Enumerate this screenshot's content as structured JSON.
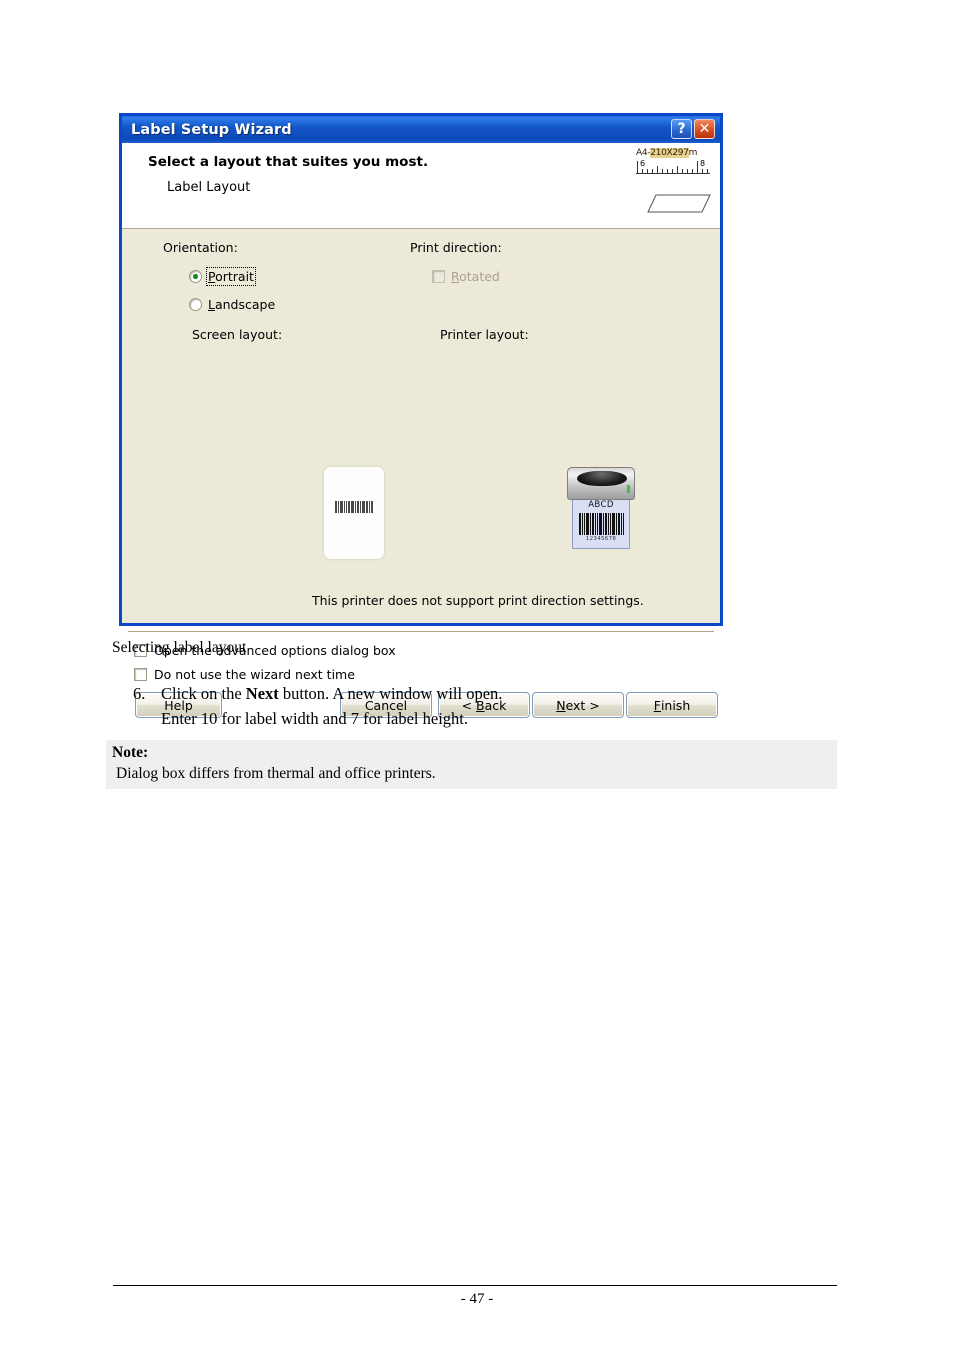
{
  "dialog": {
    "title": "Label Setup Wizard",
    "titlebar_buttons": [
      {
        "name": "help",
        "glyph": "?"
      },
      {
        "name": "close",
        "glyph": "✕"
      }
    ],
    "header": {
      "heading": "Select a layout that suites you most.",
      "subheading": "Label Layout",
      "paper_icon": {
        "prefix": "A4-",
        "highlight": "210X297",
        "suffix": "m",
        "ruler_labels": [
          "6",
          "8"
        ]
      }
    },
    "orientation": {
      "label": "Orientation:",
      "options": [
        {
          "label": "Portrait",
          "accel": "P",
          "selected": true,
          "focused": true
        },
        {
          "label": "Landscape",
          "accel": "L",
          "selected": false,
          "focused": false
        }
      ]
    },
    "print_direction": {
      "label": "Print direction:",
      "checkbox": {
        "label": "Rotated",
        "accel": "R",
        "checked": false,
        "disabled": true
      }
    },
    "screen_layout": {
      "label": "Screen layout:"
    },
    "printer_layout": {
      "label": "Printer layout:",
      "preview_text": "ABCD",
      "preview_number": "12345678"
    },
    "support_note": "This printer does not support print direction settings.",
    "footer_checkboxes": [
      {
        "label": "Open the advanced options dialog box",
        "checked": false
      },
      {
        "label": "Do not use the wizard next time",
        "checked": false
      }
    ],
    "buttons": [
      {
        "label": "Help",
        "accel": ""
      },
      {
        "label": "Cancel",
        "accel": ""
      },
      {
        "label": "< Back",
        "accel": "B"
      },
      {
        "label": "Next >",
        "accel": "N"
      },
      {
        "label": "Finish",
        "accel": "F"
      }
    ],
    "colors": {
      "titlebar": "#0d49bb",
      "border": "#0a48c8",
      "face": "#ece9d8",
      "header_bg": "#ffffff",
      "radio_dot": "#1a8f1a",
      "disabled_text": "#aca08c"
    }
  },
  "document": {
    "figure_caption": "Selecting label layout",
    "step": {
      "number": "6.",
      "line1_pre": "Click on the ",
      "line1_bold": "Next",
      "line1_post": " button. A new window will open.",
      "line2": "Enter 10 for label width and 7 for label height."
    },
    "note": {
      "heading": "Note:",
      "body": "Dialog box differs from thermal and office printers."
    },
    "page_number": "- 47 -"
  }
}
